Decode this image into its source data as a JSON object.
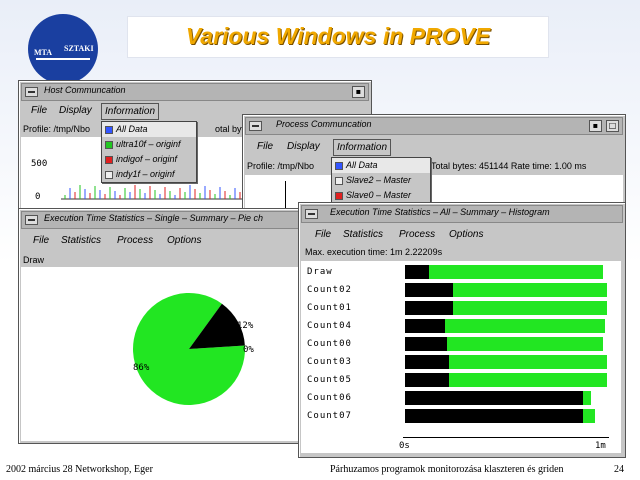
{
  "slide": {
    "title": "Various Windows in PROVE",
    "logo_left": "MTA",
    "logo_right": "SZTAKI",
    "footer_left": "2002 március 28  Networkshop, Eger",
    "footer_center": "Párhuzamos programok monitorozása klaszteren és griden",
    "page_number": "24"
  },
  "host_window": {
    "title": "Host Communcation",
    "menu": [
      "File",
      "Display",
      "Information"
    ],
    "profile_text": "Profile: /tmp/Nbo",
    "profile_right": "otal bytes:",
    "axis_500": "500",
    "axis_0": "0",
    "dropdown": [
      {
        "label": "All Data",
        "mark": "green"
      },
      {
        "label": "ultra10f – originf",
        "mark": "green"
      },
      {
        "label": "indigof – originf",
        "mark": "red"
      },
      {
        "label": "indy1f – originf",
        "mark": "none"
      }
    ]
  },
  "process_window": {
    "title": "Process Communcation",
    "menu": [
      "File",
      "Display",
      "Information"
    ],
    "profile_text": "Profile: /tmp/Nbo",
    "profile_right": "Total bytes: 451144  Rate time: 1.00 ms",
    "dropdown": [
      {
        "label": "All Data",
        "mark": "blue"
      },
      {
        "label": "Slave2 – Master",
        "mark": "none"
      },
      {
        "label": "Slave0 – Master",
        "mark": "red"
      }
    ]
  },
  "pie_window": {
    "title": "Execution Time Statistics – Single – Summary – Pie ch",
    "menu": [
      "File",
      "Statistics",
      "Process",
      "Options"
    ],
    "subtitle": "Draw",
    "labels": [
      "12%",
      "0%",
      "86%"
    ],
    "chart_data": {
      "type": "pie",
      "slices": [
        {
          "label": "86%",
          "value": 86,
          "color": "#22e622"
        },
        {
          "label": "12%",
          "value": 12,
          "color": "#000000"
        },
        {
          "label": "0%",
          "value": 2,
          "color": "#000000"
        }
      ]
    }
  },
  "hist_window": {
    "title": "Execution Time Statistics – All – Summary – Histogram",
    "menu": [
      "File",
      "Statistics",
      "Process",
      "Options"
    ],
    "max_text": "Max. execution time: 1m 2.22209s",
    "axis_start": "0s",
    "axis_end": "1m",
    "rows": [
      {
        "label": "Draw",
        "black": 12,
        "green": 86
      },
      {
        "label": "Count02",
        "black": 24,
        "green": 76
      },
      {
        "label": "Count01",
        "black": 24,
        "green": 76
      },
      {
        "label": "Count04",
        "black": 20,
        "green": 79
      },
      {
        "label": "Count00",
        "black": 21,
        "green": 77
      },
      {
        "label": "Count03",
        "black": 22,
        "green": 78
      },
      {
        "label": "Count05",
        "black": 22,
        "green": 78
      },
      {
        "label": "Count06",
        "black": 88,
        "green": 4
      },
      {
        "label": "Count07",
        "black": 88,
        "green": 6
      }
    ]
  }
}
